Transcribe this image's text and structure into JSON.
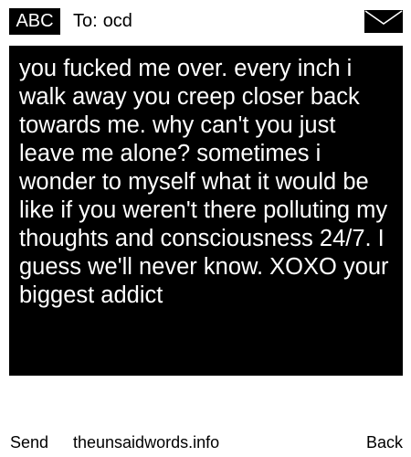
{
  "header": {
    "mode_label": "ABC",
    "to_label": "To:",
    "recipient": "ocd"
  },
  "message": {
    "body": "you fucked me over. every inch i walk away you creep closer back towards me. why can't you just leave me alone? sometimes i wonder to myself what it would be like if you weren't there polluting my thoughts and consciousness 24/7. I guess we'll never know. XOXO your biggest addict"
  },
  "softkeys": {
    "left": "Send",
    "center": "theunsaidwords.info",
    "right": "Back"
  },
  "colors": {
    "background": "#ffffff",
    "message_box": "#000000",
    "text": "#000000",
    "message_text": "#ffffff"
  },
  "icons": {
    "envelope": "envelope-icon"
  }
}
